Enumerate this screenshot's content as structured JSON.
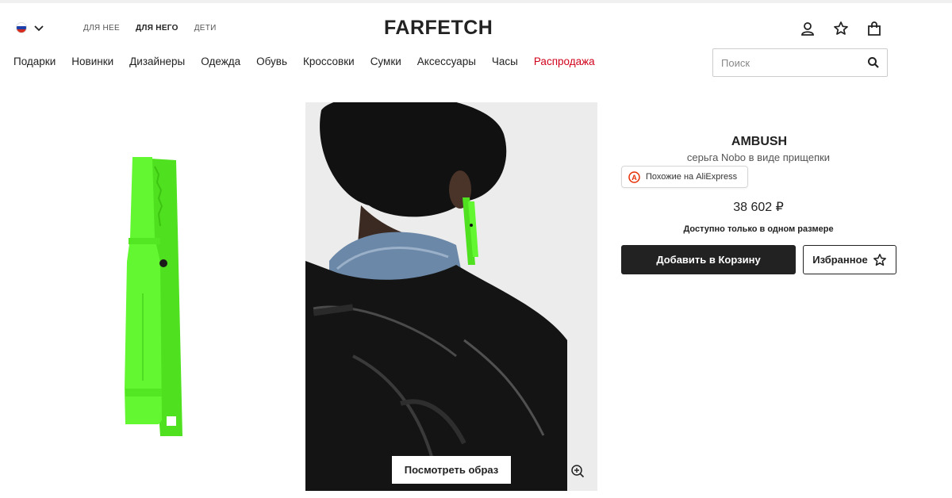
{
  "header": {
    "country_flag_colors": [
      "#ffffff",
      "#1c3faa",
      "#d52b1e"
    ],
    "gender_tabs": [
      {
        "label": "ДЛЯ НЕЕ",
        "active": false
      },
      {
        "label": "ДЛЯ НЕГО",
        "active": true
      },
      {
        "label": "ДЕТИ",
        "active": false
      }
    ],
    "logo": "FARFETCH",
    "icons": [
      "account-icon",
      "wishlist-star-icon",
      "shopping-bag-icon"
    ]
  },
  "nav": {
    "items": [
      "Подарки",
      "Новинки",
      "Дизайнеры",
      "Одежда",
      "Обувь",
      "Кроссовки",
      "Сумки",
      "Аксессуары",
      "Часы",
      "Распродажа"
    ],
    "sale_color": "#d0021b"
  },
  "search": {
    "placeholder": "Поиск"
  },
  "gallery": {
    "look_button": "Посмотреть образ",
    "product_color": "#57f22c"
  },
  "product": {
    "brand": "AMBUSH",
    "name": "серьга Nobo в виде прищепки",
    "aliexpress_label": "Похожие на AliExpress",
    "price": "38 602 ₽",
    "availability": "Доступно только в одном размере",
    "add_to_cart": "Добавить в Корзину",
    "wishlist": "Избранное"
  }
}
